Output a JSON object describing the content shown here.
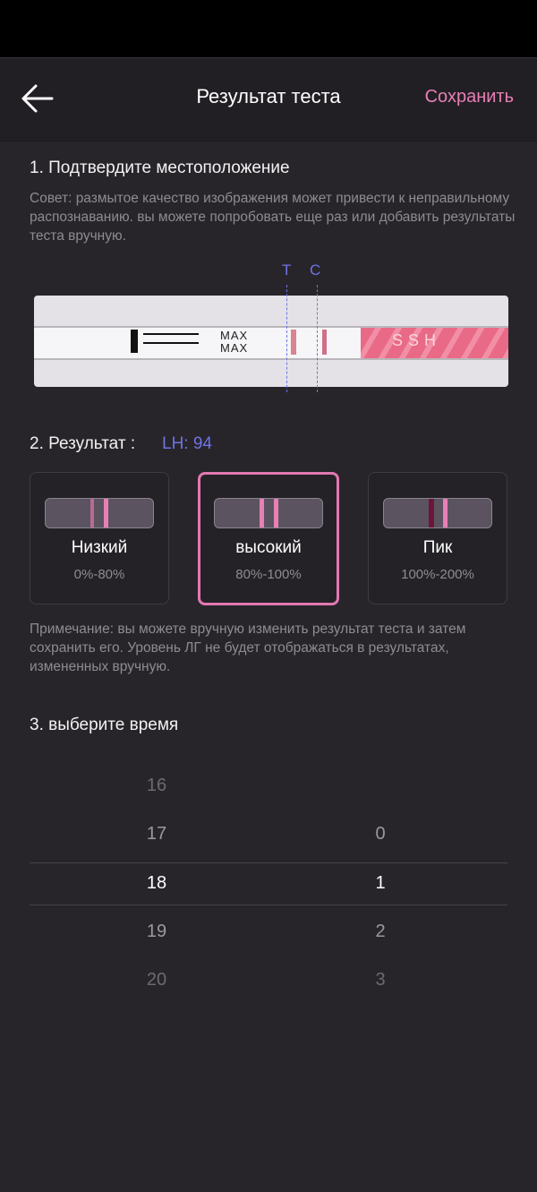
{
  "header": {
    "title": "Результат теста",
    "save_label": "Сохранить"
  },
  "section1": {
    "title": "1. Подтвердите местоположение",
    "hint": "Совет: размытое качество изображения может привести к неправильному распознаванию. вы можете попробовать еще раз или добавить результаты теста вручную.",
    "guide_t": "T",
    "guide_c": "C",
    "strip_text_1": "MAX",
    "strip_text_2": "MAX",
    "strip_brand": "SSH"
  },
  "section2": {
    "title": "2. Результат :",
    "lh_value": "LH: 94",
    "options": [
      {
        "label": "Низкий",
        "range": "0%-80%",
        "selected": false
      },
      {
        "label": "высокий",
        "range": "80%-100%",
        "selected": true
      },
      {
        "label": "Пик",
        "range": "100%-200%",
        "selected": false
      }
    ],
    "note": "Примечание: вы можете вручную изменить результат теста и затем сохранить его. Уровень ЛГ не будет отображаться в результатах, измененных вручную."
  },
  "section3": {
    "title": "3. выберите время",
    "hours": [
      "16",
      "17",
      "18",
      "19",
      "20"
    ],
    "minutes": [
      "0",
      "1",
      "2",
      "3"
    ],
    "selected_hour": "18",
    "selected_minute": "1"
  },
  "colors": {
    "accent_pink": "#e87fb6",
    "accent_blue": "#6f72e6",
    "background": "#28252a"
  }
}
